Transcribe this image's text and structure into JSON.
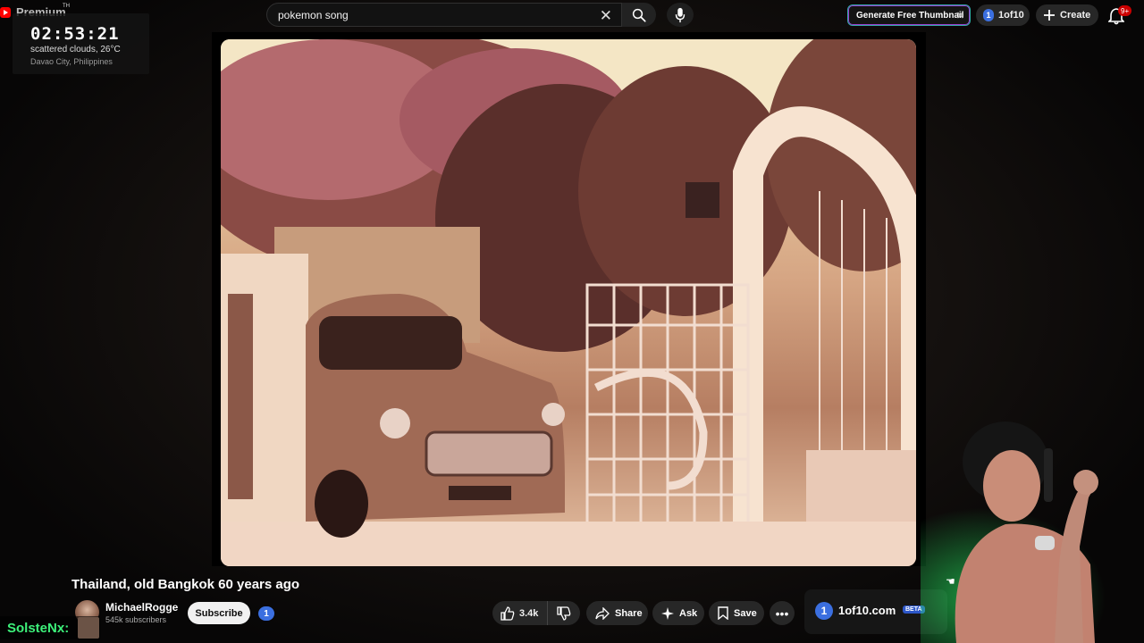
{
  "topbar": {
    "premium_label": "Premium",
    "th_label": "TH",
    "search_value": "pokemon song",
    "generate_label": "Generate Free Thumbnail",
    "oneof10_label": "1of10",
    "oneof10_badge": "1",
    "create_label": "Create",
    "notification_count": "9+"
  },
  "clock": {
    "time": "02:53:21",
    "weather": "scattered clouds, 26°C",
    "location": "Davao City, Philippines"
  },
  "video": {
    "title": "Thailand, old Bangkok 60 years ago",
    "channel_name": "MichaelRogge",
    "subscribers": "545k subscribers",
    "subscribe_label": "Subscribe",
    "oneof10_badge": "1",
    "like_count": "3.4k",
    "share_label": "Share",
    "ask_label": "Ask",
    "save_label": "Save",
    "more_label": "•••"
  },
  "extension_card": {
    "badge": "1",
    "name": "1of10.com",
    "beta_label": "BETA"
  },
  "stream_overlay": {
    "streamer_name": "SolsteNx:"
  },
  "icons": {
    "youtube": "youtube-logo-icon",
    "clear": "close-icon",
    "search": "search-icon",
    "mic": "microphone-icon",
    "create": "plus-icon",
    "bell": "bell-icon",
    "like": "thumbs-up-icon",
    "dislike": "thumbs-down-icon",
    "share": "share-arrow-icon",
    "ask": "sparkle-icon",
    "save": "bookmark-icon"
  },
  "colors": {
    "background": "#0f0f0f",
    "pill": "#272727",
    "brand_blue": "#3b6fe0",
    "streamer_green": "#3df07a",
    "notification_red": "#cc0000"
  }
}
